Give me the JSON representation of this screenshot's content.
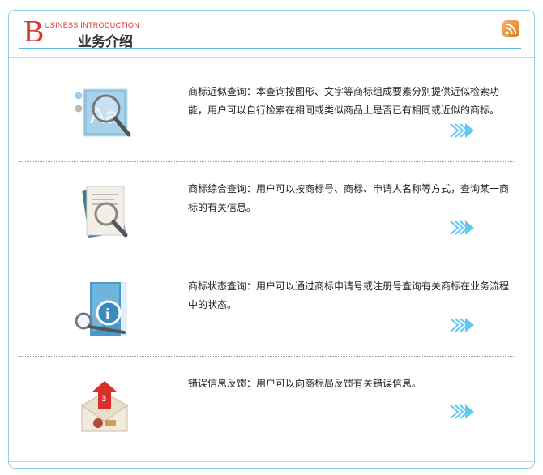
{
  "header": {
    "big_letter": "B",
    "subtitle_en": "USINESS  INTRODUCTION",
    "title": "业务介绍",
    "rss_icon": "rss-icon",
    "accent_color": "#d9362b",
    "line_color": "#5bb8dd"
  },
  "items": [
    {
      "icon": "magnifier-font-icon",
      "text": "商标近似查询：本查询按图形、文字等商标组成要素分别提供近似检索功能，用户可以自行检索在相同或类似商品上是否已有相同或近似的商标。",
      "arrow_icon": "more-arrow-icon"
    },
    {
      "icon": "document-magnifier-icon",
      "text": "商标综合查询：用户可以按商标号、商标、申请人名称等方式，查询某一商标的有关信息。",
      "arrow_icon": "more-arrow-icon"
    },
    {
      "icon": "info-book-icon",
      "text": "商标状态查询：用户可以通过商标申请号或注册号查询有关商标在业务流程中的状态。",
      "arrow_icon": "more-arrow-icon"
    },
    {
      "icon": "mail-notification-icon",
      "text": "错误信息反馈：用户可以向商标局反馈有关错误信息。",
      "badge": "3",
      "arrow_icon": "more-arrow-icon"
    }
  ]
}
